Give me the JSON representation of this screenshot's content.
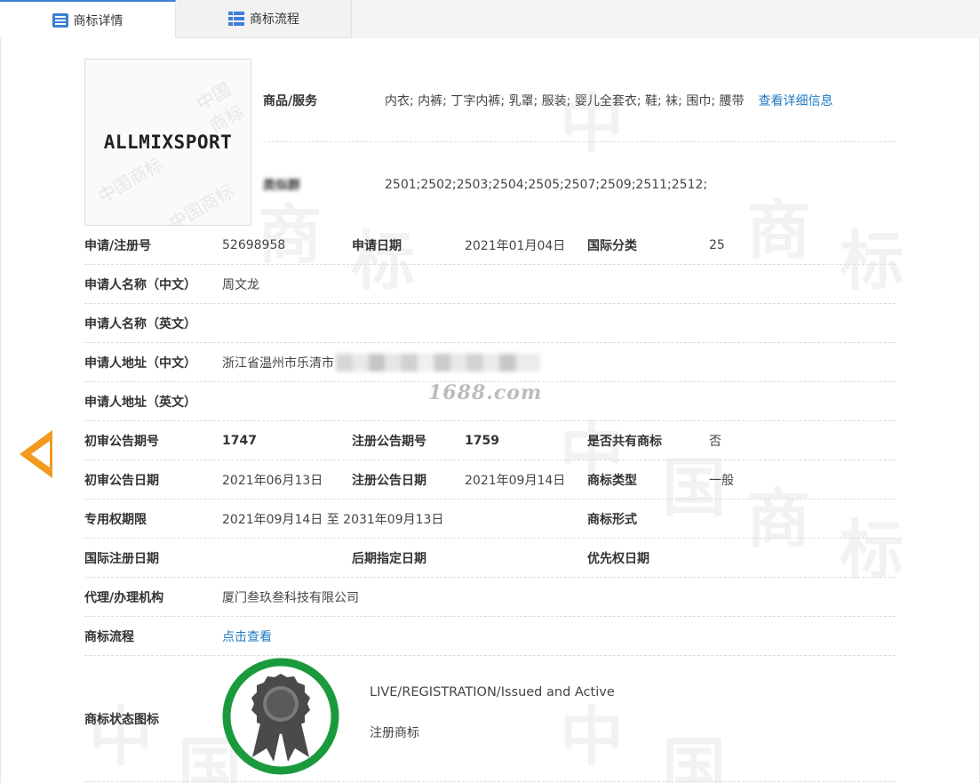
{
  "tabs": {
    "detail": "商标详情",
    "flow": "商标流程"
  },
  "trademark": {
    "logo_text": "ALLMIXSPORT",
    "logo_watermark": "中国商标"
  },
  "goods": {
    "label": "商品/服务",
    "value": "内衣; 内裤; 丁字内裤; 乳罩; 服装; 婴儿全套衣; 鞋; 袜; 围巾; 腰带",
    "link": "查看详细信息"
  },
  "similar": {
    "label": "类似群",
    "value": "2501;2502;2503;2504;2505;2507;2509;2511;2512;"
  },
  "rows": {
    "reg_no_label": "申请/注册号",
    "reg_no": "52698958",
    "apply_date_label": "申请日期",
    "apply_date": "2021年01月04日",
    "intl_class_label": "国际分类",
    "intl_class": "25",
    "applicant_cn_label": "申请人名称（中文）",
    "applicant_cn": "周文龙",
    "applicant_en_label": "申请人名称（英文）",
    "address_cn_label": "申请人地址（中文）",
    "address_cn": "浙江省温州市乐清市",
    "address_en_label": "申请人地址（英文）",
    "prelim_no_label": "初审公告期号",
    "prelim_no": "1747",
    "reg_pub_no_label": "注册公告期号",
    "reg_pub_no": "1759",
    "shared_label": "是否共有商标",
    "shared": "否",
    "prelim_date_label": "初审公告日期",
    "prelim_date": "2021年06月13日",
    "reg_pub_date_label": "注册公告日期",
    "reg_pub_date": "2021年09月14日",
    "tm_type_label": "商标类型",
    "tm_type": "一般",
    "exclusive_label": "专用权期限",
    "exclusive": "2021年09月14日 至 2031年09月13日",
    "tm_form_label": "商标形式",
    "intl_reg_label": "国际注册日期",
    "later_label": "后期指定日期",
    "priority_label": "优先权日期",
    "agent_label": "代理/办理机构",
    "agent": "厦门叁玖叁科技有限公司",
    "flow_label": "商标流程",
    "flow_link": "点击查看"
  },
  "site_mark": "1688.com",
  "status": {
    "label": "商标状态图标",
    "en": "LIVE/REGISTRATION/Issued and Active",
    "cn": "注册商标",
    "ring_color": "#1a9a3c"
  },
  "colors": {
    "link": "#1f7ac3",
    "arrow": "#f39a1e",
    "tab_accent": "#3d7fd6"
  }
}
